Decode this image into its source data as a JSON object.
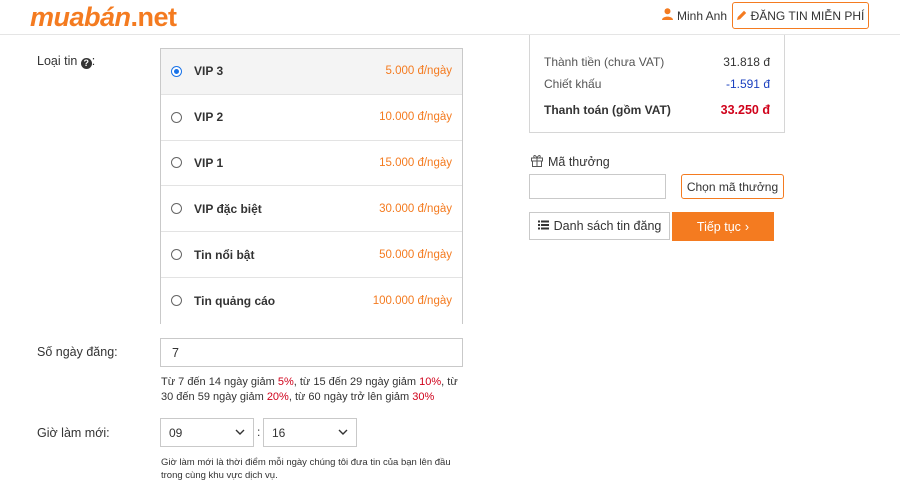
{
  "header": {
    "logo_brand": "muabán",
    "logo_tld": ".net",
    "user_name": "Minh Anh",
    "post_button": "ĐĂNG TIN MIỄN PHÍ"
  },
  "form": {
    "ad_type_label": "Loại tin",
    "ad_type_suffix": ":",
    "ad_types": [
      {
        "name": "VIP 3",
        "price": "5.000 đ/ngày",
        "selected": true
      },
      {
        "name": "VIP 2",
        "price": "10.000 đ/ngày",
        "selected": false
      },
      {
        "name": "VIP 1",
        "price": "15.000 đ/ngày",
        "selected": false
      },
      {
        "name": "VIP đặc biệt",
        "price": "30.000 đ/ngày",
        "selected": false
      },
      {
        "name": "Tin nổi bật",
        "price": "50.000 đ/ngày",
        "selected": false
      },
      {
        "name": "Tin quảng cáo",
        "price": "100.000 đ/ngày",
        "selected": false
      }
    ],
    "days_label": "Số ngày đăng:",
    "days_value": "7",
    "discount": {
      "p1": "Từ 7 đến 14 ngày giảm ",
      "v1": "5%",
      "p2": ", từ 15 đến 29 ngày giảm ",
      "v2": "10%",
      "p3": ", từ 30 đến 59 ngày giảm ",
      "v3": "20%",
      "p4": ", từ 60 ngày trở lên giảm ",
      "v4": "30%"
    },
    "refresh_label": "Giờ làm mới:",
    "hour": "09",
    "colon": ":",
    "minute": "16",
    "refresh_note": "Giờ làm mới là thời điểm mỗi ngày chúng tôi đưa tin của bạn lên đầu trong cùng khu vực dịch vụ."
  },
  "summary": {
    "subtotal_label": "Thành tiền (chưa VAT)",
    "subtotal_value": "31.818 đ",
    "discount_label": "Chiết khấu",
    "discount_value": "-1.591 đ",
    "total_label": "Thanh toán (gồm VAT)",
    "total_value": "33.250 đ"
  },
  "promo": {
    "label": "Mã thưởng",
    "input_value": "",
    "choose_button": "Chọn mã thưởng"
  },
  "actions": {
    "list_button": "Danh sách tin đăng",
    "next_button": "Tiếp tục"
  },
  "colors": {
    "accent": "#f47b20",
    "total_red": "#d0021b",
    "discount_blue": "#1a3fbf",
    "radio_blue": "#1a73e8"
  }
}
